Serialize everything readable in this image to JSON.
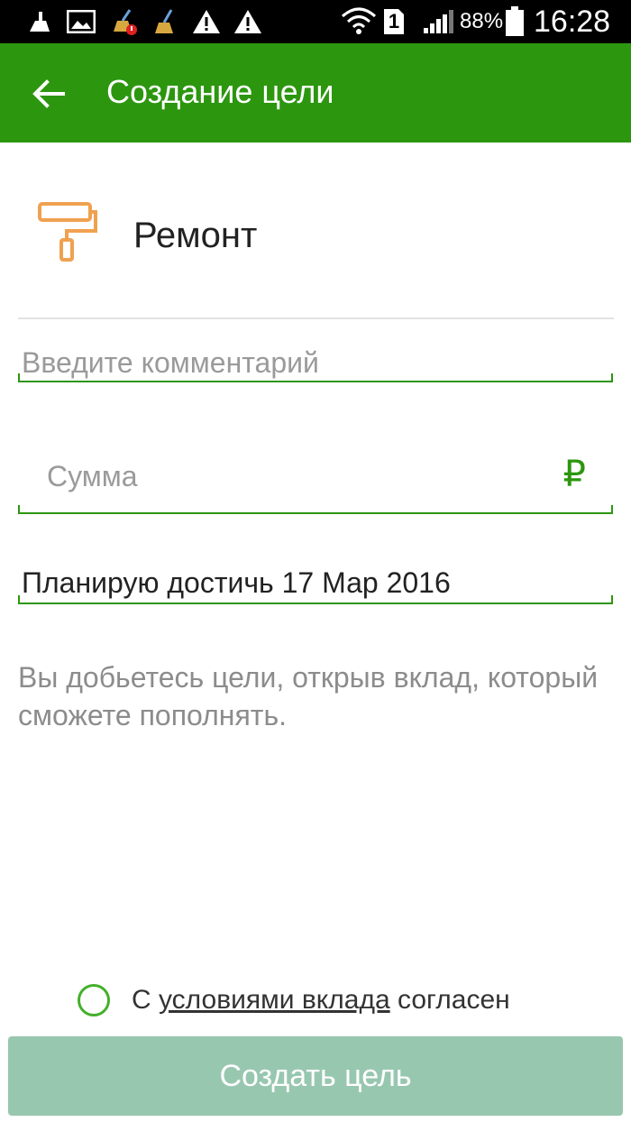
{
  "status_bar": {
    "battery_percent": "88%",
    "time": "16:28",
    "sim_slot": "1",
    "icons": [
      "cleaner-icon",
      "image-icon",
      "broom-alert-icon",
      "broom-icon",
      "warning-icon",
      "warning-icon",
      "wifi-icon",
      "sim-1-icon",
      "signal-icon",
      "battery-icon"
    ]
  },
  "app_bar": {
    "title": "Создание цели",
    "back_icon": "arrow-left-icon"
  },
  "goal": {
    "category_icon": "paint-roller-icon",
    "category_label": "Ремонт"
  },
  "form": {
    "comment_placeholder": "Введите комментарий",
    "sum_placeholder": "Сумма",
    "currency_symbol": "₽",
    "date_text": "Планирую достичь 17 Мар 2016"
  },
  "info": {
    "text": "Вы добьетесь цели, открыв вклад, который сможете пополнять."
  },
  "agreement": {
    "prefix": "С",
    "link": "условиями вклада",
    "suffix": "согласен"
  },
  "actions": {
    "create_label": "Создать цель"
  },
  "colors": {
    "app_bar": "#2c960f",
    "accent": "#2c960f",
    "icon_orange": "#f0a150",
    "button_disabled": "#98c7b0"
  }
}
